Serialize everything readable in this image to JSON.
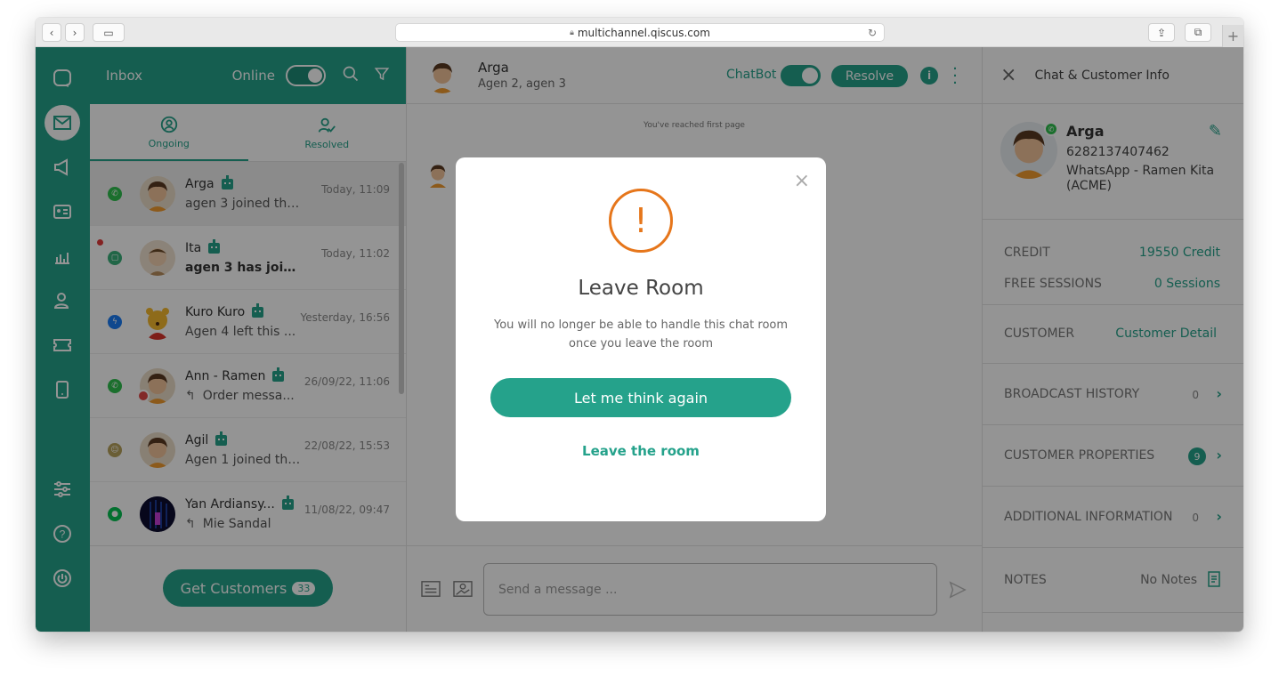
{
  "browser": {
    "url": "multichannel.qiscus.com",
    "plus": "+"
  },
  "inbox": {
    "title": "Inbox",
    "status": "Online",
    "tabs": [
      {
        "label": "Ongoing"
      },
      {
        "label": "Resolved"
      }
    ],
    "rows": [
      {
        "name": "Arga",
        "msg": "agen 3 joined thi...",
        "time": "Today, 11:09",
        "channel": "whatsapp"
      },
      {
        "name": "Ita",
        "msg": "agen 3 has joine...",
        "time": "Today, 11:02",
        "channel": "qiscus"
      },
      {
        "name": "Kuro Kuro",
        "msg": "Agen 4 left this ...",
        "time": "Yesterday, 16:56",
        "channel": "messenger"
      },
      {
        "name": "Ann - Ramen",
        "msg": "Order messa...",
        "time": "26/09/22, 11:06",
        "channel": "whatsapp"
      },
      {
        "name": "Agil",
        "msg": "Agen 1 joined thi...",
        "time": "22/08/22, 15:53",
        "channel": "custom"
      },
      {
        "name": "Yan Ardiansy...",
        "msg": "Mie Sandal",
        "time": "11/08/22, 09:47",
        "channel": "line"
      }
    ],
    "get_customers": "Get Customers",
    "get_customers_count": "33"
  },
  "chat": {
    "name": "Arga",
    "agents": "Agen 2, agen 3",
    "chatbot_label": "ChatBot",
    "resolve_label": "Resolve",
    "first_page": "You've reached first page",
    "placeholder": "Send a message ..."
  },
  "info": {
    "title": "Chat & Customer Info",
    "name": "Arga",
    "phone": "6282137407462",
    "channel_line1": "WhatsApp - Ramen Kita",
    "channel_line2": "(ACME)",
    "credit_label": "CREDIT",
    "credit_value": "19550 Credit",
    "sessions_label": "FREE SESSIONS",
    "sessions_value": "0 Sessions",
    "customer_label": "CUSTOMER",
    "customer_link": "Customer Detail",
    "broadcast_label": "BROADCAST HISTORY",
    "broadcast_count": "0",
    "props_label": "CUSTOMER PROPERTIES",
    "props_count": "9",
    "additional_label": "ADDITIONAL INFORMATION",
    "additional_count": "0",
    "notes_label": "NOTES",
    "notes_value": "No Notes"
  },
  "modal": {
    "icon": "!",
    "title": "Leave Room",
    "text_line1": "You will no longer be able to handle this chat room",
    "text_line2": "once you leave the room",
    "primary": "Let me think again",
    "secondary": "Leave the room",
    "close": "×"
  },
  "colors": {
    "accent": "#25a28b",
    "warning": "#e6761b"
  }
}
